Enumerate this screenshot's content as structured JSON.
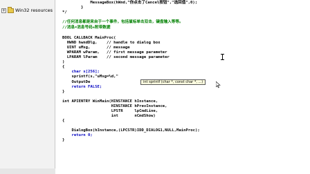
{
  "sidebar": {
    "tree_item": {
      "expander": "+",
      "label": "Win32 resources"
    }
  },
  "editor": {
    "lines": [
      "            MessageBox(hWnd,\"你点击了Cancel按钮\",\"选回值\",0);",
      "        }",
      "*/",
      "",
      "//任何消息都是来自于一个事件，包括鼠标单击双击，键盘输入等等。",
      "//消息=消息号码+附带数据",
      "",
      "BOOL CALLBACK MainProc(",
      "  HWND hwndDlg,    // handle to dialog box",
      "  UINT uMsg,       // message",
      "  WPARAM wParam,   // first message parameter",
      "  LPARAM lParam    // second message parameter",
      ")",
      "{",
      "    char s[256];",
      "    sprintf(s,\"uMsg=%d,\"",
      "    OutputDe",
      "    return FALSE;",
      "}",
      "",
      "int APIENTRY WinMain(HINSTANCE hInstance,",
      "                     HINSTANCE hPrevInstance,",
      "                     LPSTR     lpCmdLine,",
      "                     int       nCmdShow)",
      "{",
      "",
      "    DialogBox(hInstance,(LPCSTR)IDD_DIALOG1,NULL,MainProc);",
      "    return 0;",
      "}"
    ],
    "tooltip": "int sprintf (char *, const char *, ...)"
  },
  "colors": {
    "comment": "#008000",
    "keyword": "#0000c0",
    "string": "#a31515",
    "tooltip_bg": "#ffffe1",
    "panel_bg": "#f2f2f2"
  }
}
